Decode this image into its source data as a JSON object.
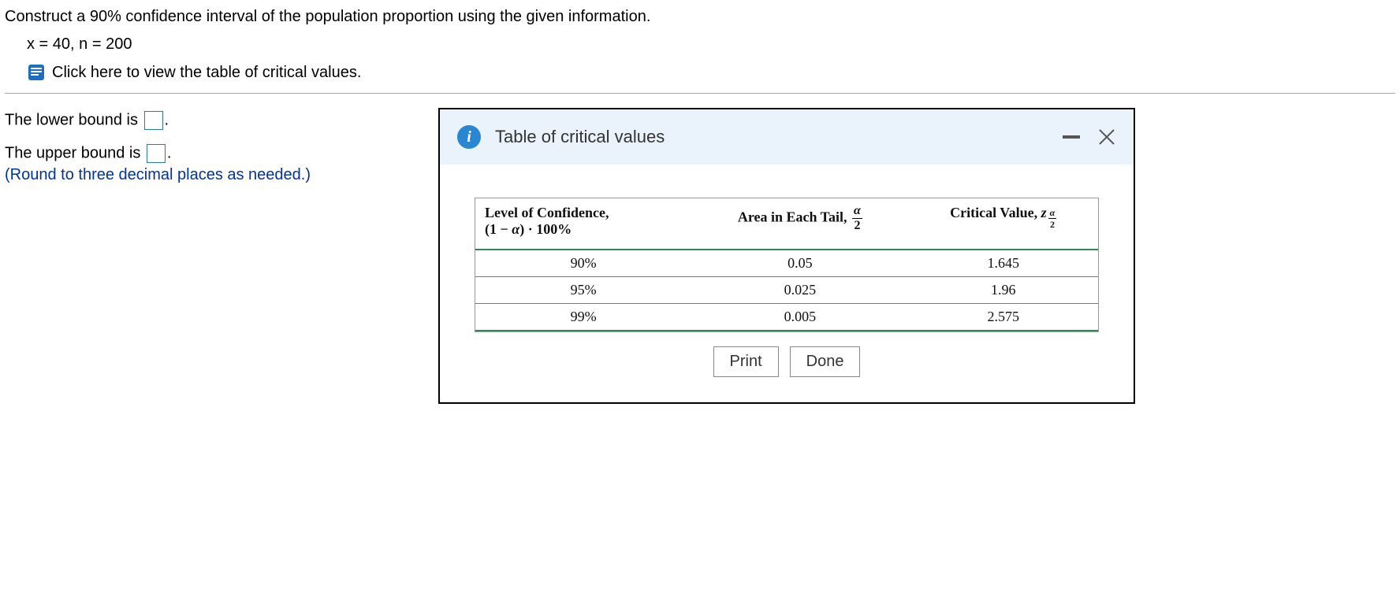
{
  "question": {
    "prompt": "Construct a 90% confidence interval of the population proportion using the given information.",
    "given": "x = 40, n = 200",
    "link_text": "Click here to view the table of critical values."
  },
  "answers": {
    "lower_label_pre": "The lower bound is ",
    "lower_label_post": ".",
    "upper_label_pre": "The upper bound is ",
    "upper_label_post": ".",
    "round_note": "(Round to three decimal places as needed.)"
  },
  "popup": {
    "title": "Table of critical values",
    "print_label": "Print",
    "done_label": "Done"
  },
  "table": {
    "headers": {
      "col1_line1": "Level of Confidence,",
      "col1_line2_pre": "(1 − ",
      "col1_line2_alpha": "α",
      "col1_line2_post": ") · 100%",
      "col2_pre": "Area in Each Tail, ",
      "col2_frac_num": "α",
      "col2_frac_den": "2",
      "col3_pre": "Critical Value, ",
      "col3_z": "z",
      "col3_sub_num": "α",
      "col3_sub_den": "2"
    },
    "rows": [
      {
        "level": "90%",
        "tail": "0.05",
        "z": "1.645"
      },
      {
        "level": "95%",
        "tail": "0.025",
        "z": "1.96"
      },
      {
        "level": "99%",
        "tail": "0.005",
        "z": "2.575"
      }
    ]
  }
}
